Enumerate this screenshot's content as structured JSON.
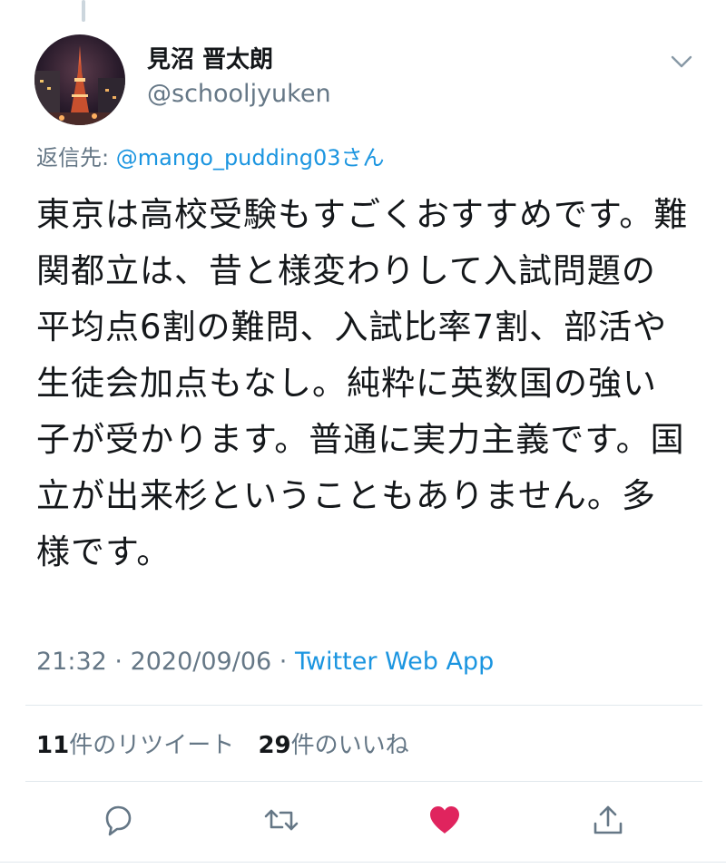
{
  "author": {
    "name": "見沼 晋太朗",
    "handle": "@schooljyuken"
  },
  "reply": {
    "prefix": "返信先:",
    "mention": "@mango_pudding03",
    "suffix": "さん"
  },
  "tweet": {
    "text": "東京は高校受験もすごくおすすめです。難関都立は、昔と様変わりして入試問題の平均点6割の難問、入試比率7割、部活や生徒会加点もなし。純粋に英数国の強い子が受かります。普通に実力主義です。国立が出来杉ということもありません。多様です。"
  },
  "meta": {
    "time": "21:32",
    "separator1": " · ",
    "date": "2020/09/06",
    "separator2": " · ",
    "source": "Twitter Web App"
  },
  "stats": {
    "retweets_count": "11",
    "retweets_label": "件のリツイート",
    "likes_count": "29",
    "likes_label": "件のいいね"
  },
  "icons": {
    "reply": "reply-icon",
    "retweet": "retweet-icon",
    "like": "heart-icon",
    "share": "share-icon",
    "menu": "chevron-down-icon"
  },
  "colors": {
    "link": "#1b95e0",
    "secondary_text": "#657786",
    "like_active": "#e0245e",
    "divider": "#e1e8ed"
  }
}
